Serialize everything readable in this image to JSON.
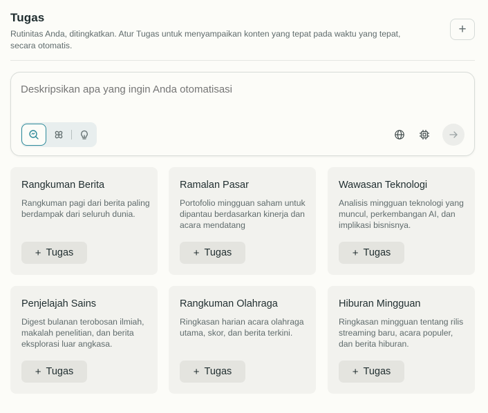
{
  "header": {
    "title": "Tugas",
    "subtitle": "Rutinitas Anda, ditingkatkan. Atur Tugas untuk menyampaikan konten yang tepat pada waktu yang tepat, secara otomatis.",
    "add_label": "+"
  },
  "prompt": {
    "placeholder": "Deskripsikan apa yang ingin Anda otomatisasi",
    "modes": [
      "search-icon",
      "sparkle-icon",
      "lightbulb-icon"
    ],
    "tools": [
      "globe-icon",
      "chip-icon",
      "arrow-right-icon"
    ]
  },
  "cards": [
    {
      "title": "Rangkuman Berita",
      "desc": "Rangkuman pagi dari berita paling berdampak dari seluruh dunia.",
      "button": "Tugas"
    },
    {
      "title": "Ramalan Pasar",
      "desc": "Portofolio mingguan saham untuk dipantau berdasarkan kinerja dan acara mendatang",
      "button": "Tugas"
    },
    {
      "title": "Wawasan Teknologi",
      "desc": "Analisis mingguan teknologi yang muncul, perkembangan AI, dan implikasi bisnisnya.",
      "button": "Tugas"
    },
    {
      "title": "Penjelajah Sains",
      "desc": "Digest bulanan terobosan ilmiah, makalah penelitian, dan berita eksplorasi luar angkasa.",
      "button": "Tugas"
    },
    {
      "title": "Rangkuman Olahraga",
      "desc": "Ringkasan harian acara olahraga utama, skor, dan berita terkini.",
      "button": "Tugas"
    },
    {
      "title": "Hiburan Mingguan",
      "desc": "Ringkasan mingguan tentang rilis streaming baru, acara populer, dan berita hiburan.",
      "button": "Tugas"
    }
  ],
  "colors": {
    "accent": "#2d8a9a",
    "card_bg": "#f2f2ee",
    "page_bg": "#fcfcf8"
  }
}
